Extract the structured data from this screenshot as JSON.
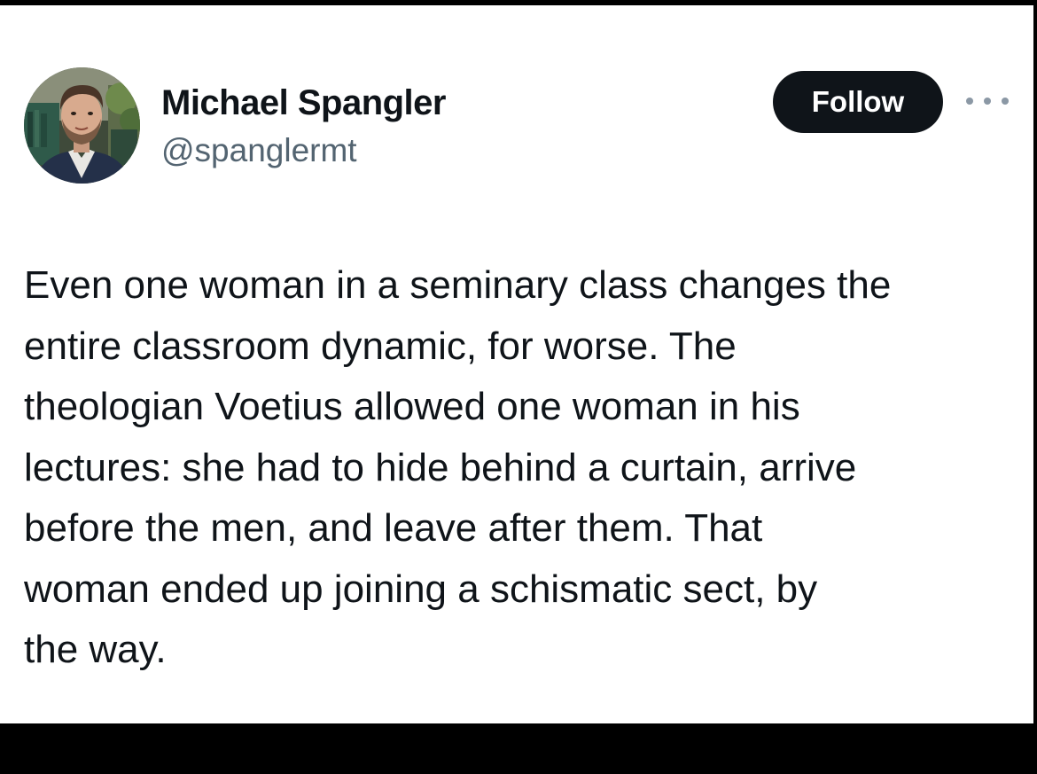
{
  "author": {
    "name": "Michael Spangler",
    "handle": "@spanglermt"
  },
  "actions": {
    "follow_label": "Follow",
    "more_icon": "more-horizontal-icon"
  },
  "tweet": {
    "lines": [
      "Even one woman in a seminary class changes the",
      "entire classroom dynamic, for worse. The",
      "theologian Voetius allowed one woman in his",
      "lectures: she had to hide behind a curtain, arrive",
      "before the men, and leave after them. That",
      "woman ended up joining a schismatic sect, by",
      "the way."
    ]
  },
  "colors": {
    "text_primary": "#0f1419",
    "text_secondary": "#536471",
    "follow_button_bg": "#0f1419",
    "frame": "#000000",
    "card": "#ffffff"
  }
}
